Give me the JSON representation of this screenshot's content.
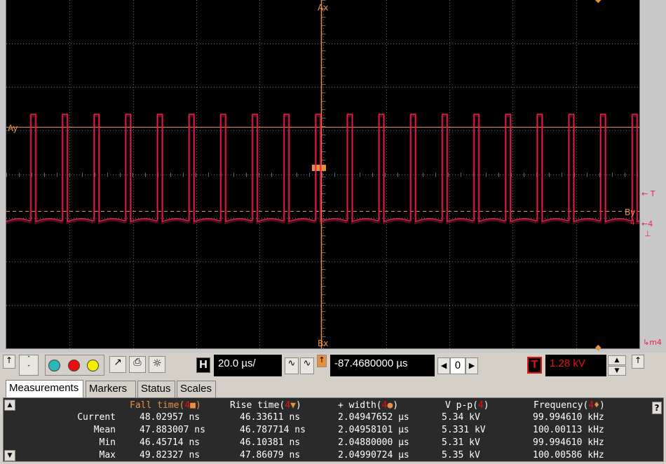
{
  "scope": {
    "labels": {
      "ax": "Ax",
      "bx": "Bx",
      "ay": "Ay",
      "by": "By",
      "trigger_marker": "T",
      "ch4_marker": "4",
      "ch4_marker_right": "4",
      "m4": "m4"
    },
    "colors": {
      "trace": "#e8204a",
      "cursor": "#e89040",
      "grid": "#6a6a6a",
      "background": "#000000"
    }
  },
  "toolbar": {
    "arrow_up": "↑",
    "horizontal_label": "H",
    "time_per_div": "20.0 µs/",
    "position": "-87.4680000 µs",
    "position_step": "0",
    "trigger_label": "T",
    "trigger_level": "1.28 kV",
    "channel_colors": [
      "#2ab8b8",
      "#e81010",
      "#f0f000"
    ]
  },
  "tabs": [
    "Measurements",
    "Markers",
    "Status",
    "Scales"
  ],
  "measurements": {
    "headers": [
      {
        "name": "Fall time",
        "channel": "4",
        "symbol": "■"
      },
      {
        "name": "Rise time",
        "channel": "4",
        "symbol": "▼"
      },
      {
        "name": "+ width",
        "channel": "4",
        "symbol": "●"
      },
      {
        "name": "V p-p",
        "channel": "4",
        "symbol": ""
      },
      {
        "name": "Frequency",
        "channel": "4",
        "symbol": "♦"
      }
    ],
    "rows": [
      {
        "label": "Current",
        "values": [
          "48.02957 ns",
          "46.33611 ns",
          "2.04947652 µs",
          "5.34 kV",
          "99.994610 kHz"
        ]
      },
      {
        "label": "Mean",
        "values": [
          "47.883007 ns",
          "46.787714 ns",
          "2.04958101 µs",
          "5.331 kV",
          "100.00113 kHz"
        ]
      },
      {
        "label": "Min",
        "values": [
          "46.45714 ns",
          "46.10381 ns",
          "2.04880000 µs",
          "5.31 kV",
          "99.994610 kHz"
        ]
      },
      {
        "label": "Max",
        "values": [
          "49.82327 ns",
          "47.86079 ns",
          "2.04990724 µs",
          "5.35 kV",
          "100.00586 kHz"
        ]
      }
    ],
    "help": "?"
  }
}
